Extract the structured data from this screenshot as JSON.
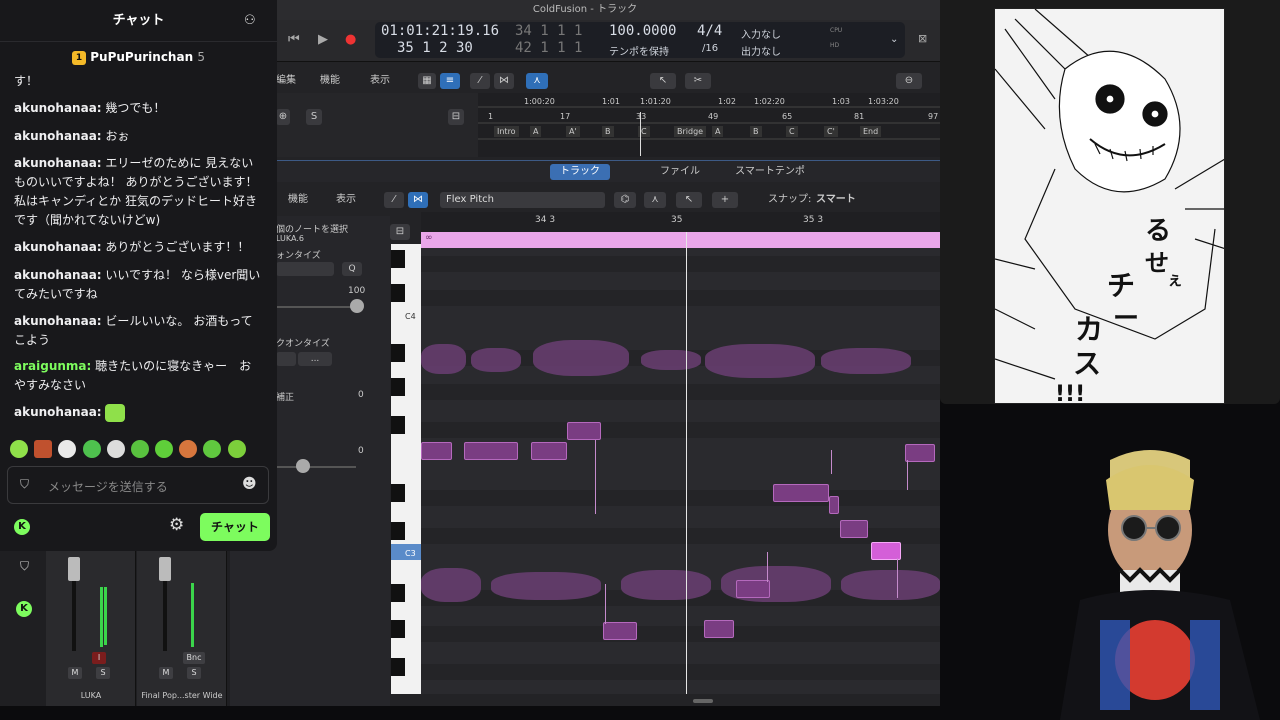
{
  "logic": {
    "window_title": "ColdFusion - トラック",
    "lcd": {
      "time": "01:01:21:19.16",
      "bars": "35  1  2   30",
      "bars_dim": "34  1  1   1",
      "bars_dim2": "42  1  1   1",
      "tempo": "100.0000",
      "tempo_mode": "テンポを保持",
      "sig_top": "4/4",
      "sig_bottom": "/16",
      "input": "入力なし",
      "output": "出力なし",
      "cpu": "CPU",
      "hd": "HD"
    },
    "toolbar": {
      "edit": "編集",
      "func": "機能",
      "view": "表示",
      "s": "S"
    },
    "ruler": {
      "times": [
        "1:00:20",
        "1:01",
        "1:01:20",
        "1:02",
        "1:02:20",
        "1:03",
        "1:03:20"
      ],
      "bars": [
        "1",
        "17",
        "33",
        "49",
        "65",
        "81",
        "97"
      ],
      "markers": [
        "Intro",
        "A",
        "A'",
        "B",
        "C",
        "Bridge",
        "A",
        "B",
        "C",
        "C'",
        "End"
      ]
    },
    "tabs": [
      "トラック",
      "ファイル",
      "スマートテンポ"
    ],
    "editor": {
      "func": "機能",
      "view": "表示",
      "flex_mode": "Flex Pitch",
      "snap_label": "スナップ:",
      "snap_value": "スマート",
      "ruler_labels": [
        "34 3",
        "35",
        "35 3"
      ]
    },
    "inspector": {
      "selected_notes": "個のノートを選択",
      "region": "LUKA.6",
      "quantize": "ォンタイズ",
      "q": "Q",
      "value_100": "100",
      "scale_quantize": "クオンタイズ",
      "dots": "...",
      "correction": "補正",
      "value_0a": "0",
      "value_0b": "0"
    },
    "keys": {
      "c4": "C4",
      "c3": "C3"
    },
    "mixer": {
      "strips": [
        {
          "name": "LUKA",
          "m": "M",
          "s": "S",
          "i": "I"
        },
        {
          "name": "Final Pop...ster Wide",
          "m": "M",
          "s": "S",
          "bnc": "Bnc"
        }
      ]
    }
  },
  "chat": {
    "title": "チャット",
    "pinned_user": "PuPuPurinchan",
    "pinned_count": "5",
    "messages": [
      {
        "user": "",
        "text": "す！"
      },
      {
        "user": "akunohanaa:",
        "text": "幾つでも！"
      },
      {
        "user": "akunohanaa:",
        "text": "おぉ"
      },
      {
        "user": "akunohanaa:",
        "text": "エリーゼのために 見えないものいいですよね！ ありがとうございます！ 私はキャンディとか 狂気のデッドヒート好きです（聞かれてないけどw)"
      },
      {
        "user": "akunohanaa:",
        "text": "ありがとうございます！！"
      },
      {
        "user": "akunohanaa:",
        "text": "いいですね！ なら様ver聞いてみたいですね"
      },
      {
        "user": "akunohanaa:",
        "text": "ビールいいな。 お酒もってこよう"
      },
      {
        "user": "araigunma:",
        "text": "聴きたいのに寝なきゃー　おやすみなさい"
      },
      {
        "user": "akunohanaa:",
        "text": ""
      }
    ],
    "input_placeholder": "メッセージを送信する",
    "send_label": "チャット",
    "colors": {
      "accent": "#7dfc5e",
      "user_araigunma": "#7dfc5e"
    }
  },
  "manga": {
    "caption": "るせぇチーカス!!!"
  }
}
